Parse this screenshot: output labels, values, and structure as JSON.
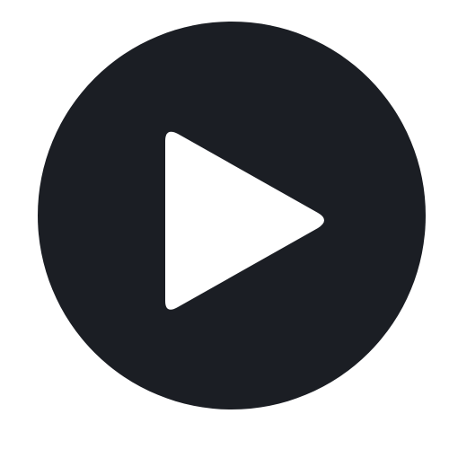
{
  "play_button": {
    "icon": "play-icon",
    "background_color": "#1b1e24",
    "icon_color": "#ffffff"
  },
  "page": {
    "background_color": "#ffffff"
  }
}
